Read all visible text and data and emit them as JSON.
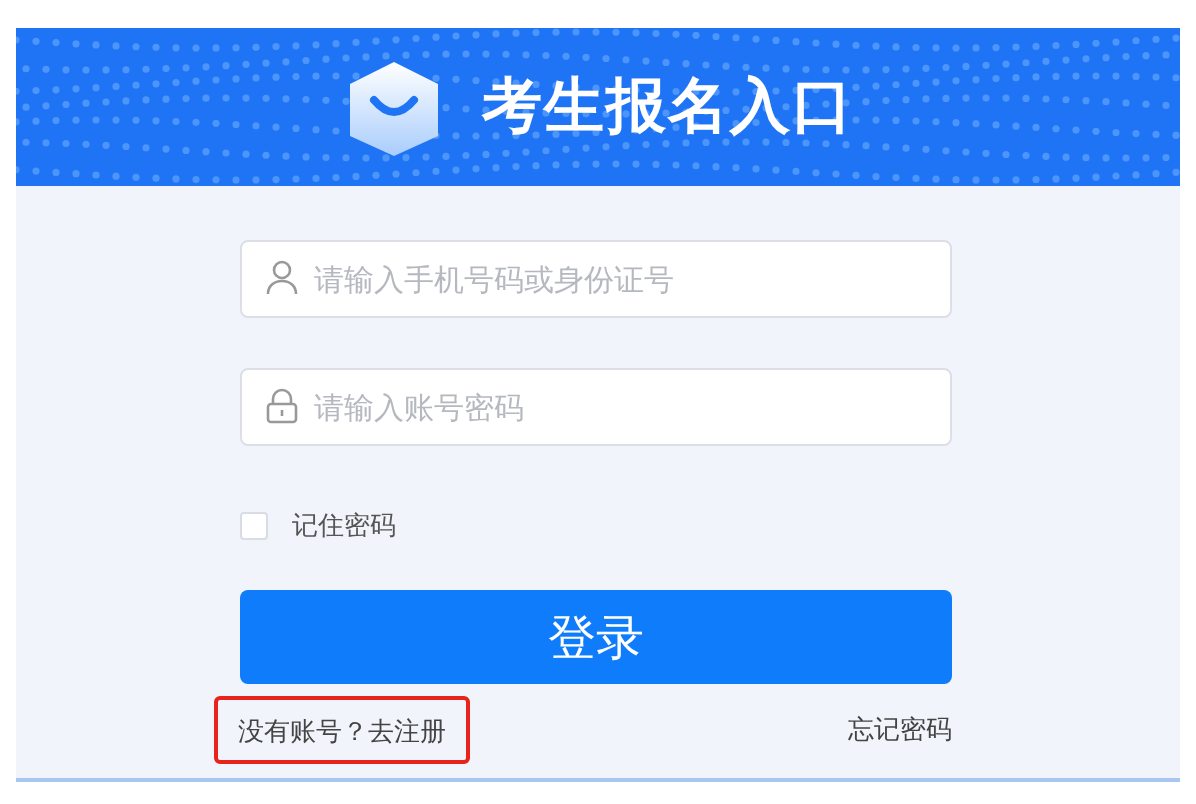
{
  "header": {
    "title": "考生报名入口"
  },
  "form": {
    "fields": [
      {
        "kind": "user",
        "placeholder": "请输入手机号码或身份证号"
      },
      {
        "kind": "lock",
        "placeholder": "请输入账号密码"
      }
    ],
    "remember": {
      "label": "记住密码",
      "checked": false
    },
    "submit": "登录",
    "register": {
      "text": "没有账号？去注册",
      "highlighted": true
    },
    "forgot": "忘记密码"
  }
}
